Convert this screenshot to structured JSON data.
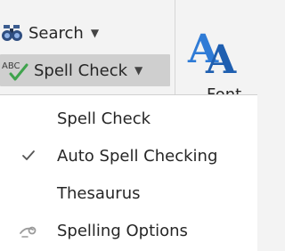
{
  "ribbon": {
    "search_label": "Search",
    "search_caret": "▼",
    "spell_icon_text": "ABC",
    "spell_label": "Spell Check",
    "spell_caret": "▼",
    "font_label": "Font"
  },
  "menu": {
    "items": [
      {
        "label": "Spell Check",
        "icon": "none",
        "checked": false
      },
      {
        "label": "Auto Spell Checking",
        "icon": "check-icon",
        "checked": true
      },
      {
        "label": "Thesaurus",
        "icon": "none",
        "checked": false
      },
      {
        "label": "Spelling Options",
        "icon": "spelling-options-icon",
        "checked": false
      }
    ]
  },
  "colors": {
    "accent_blue": "#2b6cb8",
    "active_button_bg": "#cfcfcf",
    "menu_bg": "#ffffff",
    "ribbon_bg": "#f3f3f3"
  }
}
